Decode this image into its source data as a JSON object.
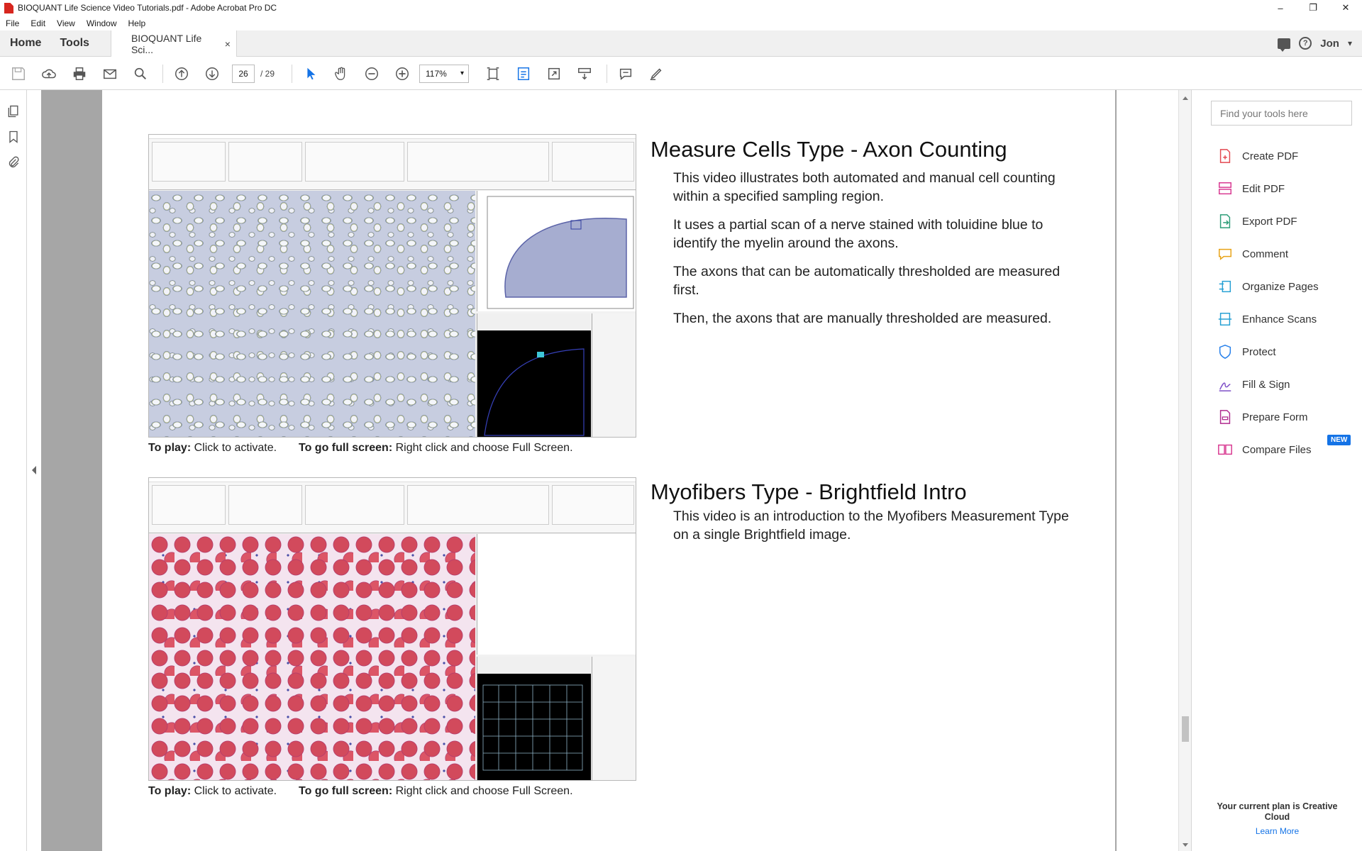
{
  "window": {
    "title": "BIOQUANT Life Science Video Tutorials.pdf - Adobe Acrobat Pro DC",
    "controls": {
      "minimize": "–",
      "maximize": "❐",
      "close": "✕"
    }
  },
  "menu": [
    "File",
    "Edit",
    "View",
    "Window",
    "Help"
  ],
  "tabs": {
    "home": "Home",
    "tools": "Tools",
    "document": "BIOQUANT Life Sci...",
    "close": "×"
  },
  "account": {
    "user": "Jon",
    "caret": "▾"
  },
  "toolbar": {
    "page_current": "26",
    "page_total": "/ 29",
    "zoom": "117%",
    "zoom_caret": "▾"
  },
  "document": {
    "sections": [
      {
        "heading": "Measure Cells Type - Axon Counting",
        "paragraphs": [
          "This video illustrates both automated and manual cell counting within a specified sampling region.",
          "It uses a partial scan of a nerve stained with toluidine blue to identify the myelin around the axons.",
          "The axons that can be automatically thresholded are measured first.",
          "Then, the axons that are manually thresholded are measured."
        ],
        "caption": {
          "play_label": "To play:",
          "play_text": "Click to activate.",
          "full_label": "To go full screen:",
          "full_text": "Right click and choose Full Screen."
        }
      },
      {
        "heading": "Myofibers Type - Brightfield Intro",
        "paragraphs": [
          "This video is an introduction to the Myofibers Measurement Type on a single Brightfield image."
        ],
        "caption": {
          "play_label": "To play:",
          "play_text": "Click to activate.",
          "full_label": "To go full screen:",
          "full_text": "Right click and choose Full Screen."
        }
      }
    ]
  },
  "tools_pane": {
    "search_placeholder": "Find your tools here",
    "items": [
      {
        "label": "Create PDF",
        "icon": "create-pdf-icon",
        "color": "#e34850"
      },
      {
        "label": "Edit PDF",
        "icon": "edit-pdf-icon",
        "color": "#d83790"
      },
      {
        "label": "Export PDF",
        "icon": "export-pdf-icon",
        "color": "#2d9d78"
      },
      {
        "label": "Comment",
        "icon": "comment-icon",
        "color": "#e8a317"
      },
      {
        "label": "Organize Pages",
        "icon": "organize-pages-icon",
        "color": "#26a0d4"
      },
      {
        "label": "Enhance Scans",
        "icon": "enhance-scans-icon",
        "color": "#26a0d4"
      },
      {
        "label": "Protect",
        "icon": "protect-icon",
        "color": "#2680eb"
      },
      {
        "label": "Fill & Sign",
        "icon": "fill-sign-icon",
        "color": "#7e4fc7"
      },
      {
        "label": "Prepare Form",
        "icon": "prepare-form-icon",
        "color": "#b02b8f"
      },
      {
        "label": "Compare Files",
        "icon": "compare-files-icon",
        "color": "#d83790",
        "badge": "NEW"
      }
    ],
    "plan_text": "Your current plan is Creative Cloud",
    "learn_more": "Learn More"
  }
}
